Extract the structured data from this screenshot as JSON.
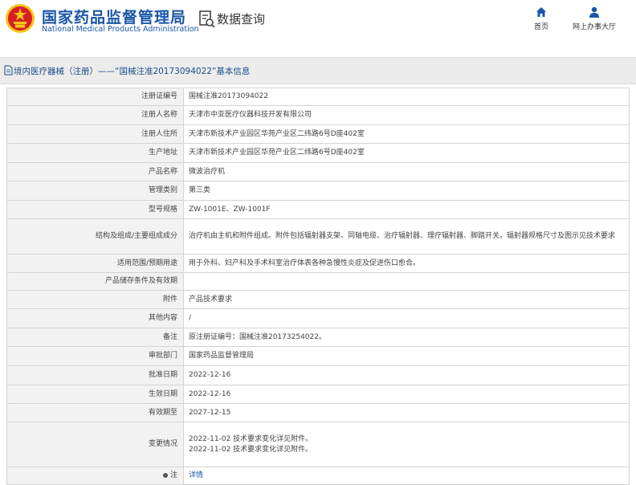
{
  "header": {
    "org_cn": "国家药品监督管理局",
    "org_en": "National Medical Products Administration",
    "query_title": "数据查询",
    "nav": [
      {
        "label": "首页",
        "icon": "home-icon"
      },
      {
        "label": "网上办事大厅",
        "icon": "user-icon"
      }
    ]
  },
  "page_title": "境内医疗器械（注册）——“国械注准20173094022”基本信息",
  "colors": {
    "brand_blue": "#1a56a8",
    "emblem_red": "#d71f26",
    "emblem_gold": "#f5c518"
  },
  "rows": [
    {
      "label": "注册证编号",
      "values": [
        "国械注准20173094022"
      ]
    },
    {
      "label": "注册人名称",
      "values": [
        "天津市中亚医疗仪器科技开发有限公司"
      ]
    },
    {
      "label": "注册人住所",
      "values": [
        "天津市新技术产业园区华苑产业区二纬路6号D座402室"
      ]
    },
    {
      "label": "生产地址",
      "values": [
        "天津市新技术产业园区华苑产业区二纬路6号D座402室"
      ]
    },
    {
      "label": "产品名称",
      "values": [
        "微波治疗机"
      ]
    },
    {
      "label": "管理类别",
      "values": [
        "第三类"
      ]
    },
    {
      "label": "型号规格",
      "values": [
        "ZW-1001E、ZW-1001F"
      ]
    },
    {
      "label": "结构及组成/主要组成成分",
      "values": [
        "治疗机由主机和附件组成。附件包括辐射器支架、同轴电缆、治疗辐射器、理疗辐射器、脚踏开关。辐射器规格尺寸及图示见技术要求"
      ]
    },
    {
      "label": "适用范围/预期用途",
      "values": [
        "用于外科、妇产科及手术科室治疗体表各种急慢性炎症及促进伤口愈合。"
      ]
    },
    {
      "label": "产品储存条件及有效期",
      "values": [
        ""
      ]
    },
    {
      "label": "附件",
      "values": [
        "产品技术要求"
      ]
    },
    {
      "label": "其他内容",
      "values": [
        "/"
      ]
    },
    {
      "label": "备注",
      "values": [
        "原注册证编号：国械注准20173254022。"
      ]
    },
    {
      "label": "审批部门",
      "values": [
        "国家药品监督管理局"
      ]
    },
    {
      "label": "批准日期",
      "values": [
        "2022-12-16"
      ]
    },
    {
      "label": "生效日期",
      "values": [
        "2022-12-16"
      ]
    },
    {
      "label": "有效期至",
      "values": [
        "2027-12-15"
      ]
    },
    {
      "label": "变更情况",
      "values": [
        "2022-11-02 技术要求变化详见附件。",
        "2022-11-02 技术要求变化详见附件。"
      ]
    },
    {
      "label": "注",
      "values": [
        "详情"
      ],
      "label_icon": "dot-icon",
      "link": true
    }
  ]
}
